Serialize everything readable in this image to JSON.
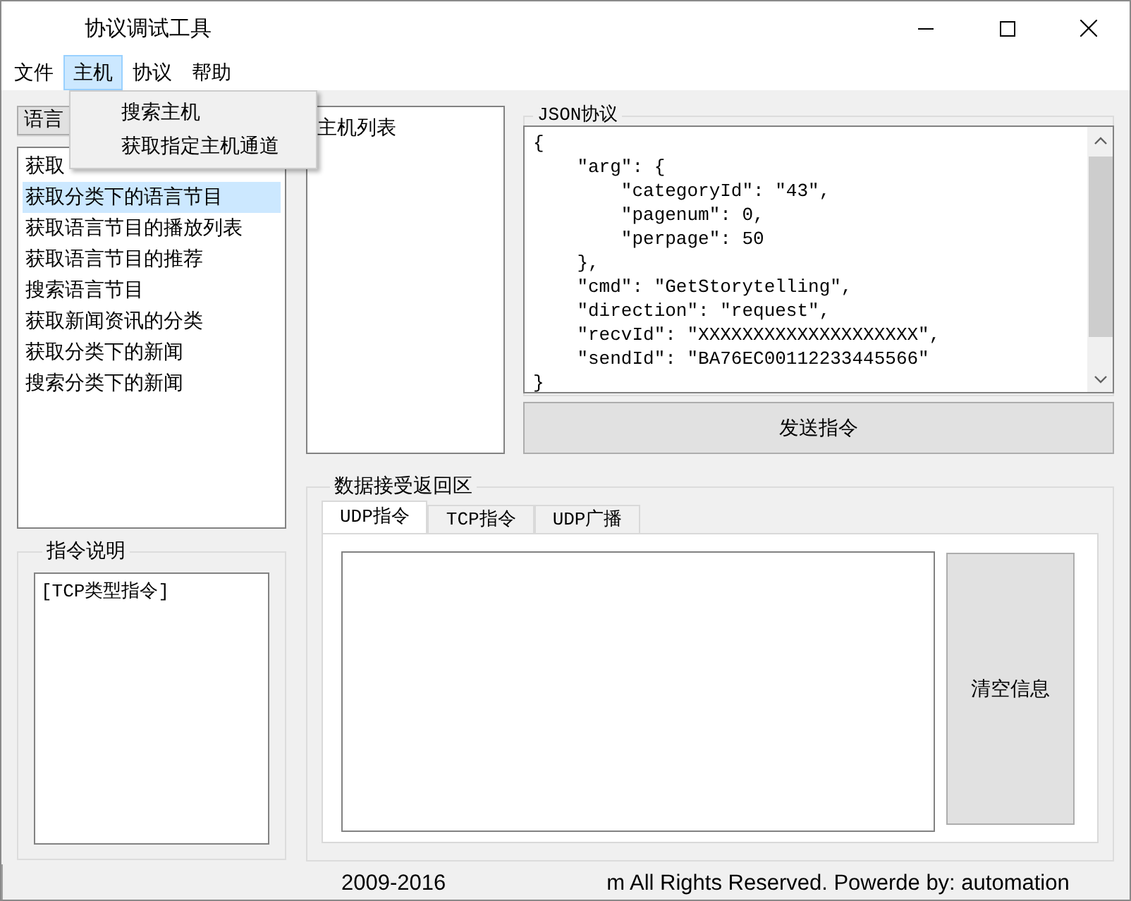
{
  "window": {
    "title": "协议调试工具"
  },
  "menu": [
    {
      "label": "文件",
      "expanded": false
    },
    {
      "label": "主机",
      "expanded": true
    },
    {
      "label": "协议",
      "expanded": false
    },
    {
      "label": "帮助",
      "expanded": false
    }
  ],
  "menu_popup": {
    "items": [
      "搜索主机",
      "获取指定主机通道"
    ]
  },
  "category_tab": {
    "label": "语言"
  },
  "command_list": [
    {
      "label": "获取",
      "selected": false
    },
    {
      "label": "获取分类下的语言节目",
      "selected": true
    },
    {
      "label": "获取语言节目的播放列表",
      "selected": false
    },
    {
      "label": "获取语言节目的推荐",
      "selected": false
    },
    {
      "label": "搜索语言节目",
      "selected": false
    },
    {
      "label": "获取新闻资讯的分类",
      "selected": false
    },
    {
      "label": "获取分类下的新闻",
      "selected": false
    },
    {
      "label": "搜索分类下的新闻",
      "selected": false
    }
  ],
  "command_description": {
    "title": "指令说明",
    "text": "[TCP类型指令]"
  },
  "host_list": {
    "title": "主机列表"
  },
  "json_protocol": {
    "title": "JSON协议",
    "lines": [
      "{",
      "    \"arg\": {",
      "        \"categoryId\": \"43\",",
      "        \"pagenum\": 0,",
      "        \"perpage\": 50",
      "    },",
      "    \"cmd\": \"GetStorytelling\",",
      "    \"direction\": \"request\",",
      "    \"recvId\": \"XXXXXXXXXXXXXXXXXXXX\",",
      "    \"sendId\": \"BA76EC00112233445566\"",
      "}"
    ]
  },
  "send_button": "发送指令",
  "receive": {
    "title": "数据接受返回区",
    "tabs": [
      {
        "label": "UDP指令",
        "selected": true
      },
      {
        "label": "TCP指令",
        "selected": false
      },
      {
        "label": "UDP广播",
        "selected": false
      }
    ],
    "clear_button": "清空信息"
  },
  "status_bar": {
    "text_start": "2009-2016",
    "text_end": "m All Rights Reserved. Powerde by:  automation"
  }
}
